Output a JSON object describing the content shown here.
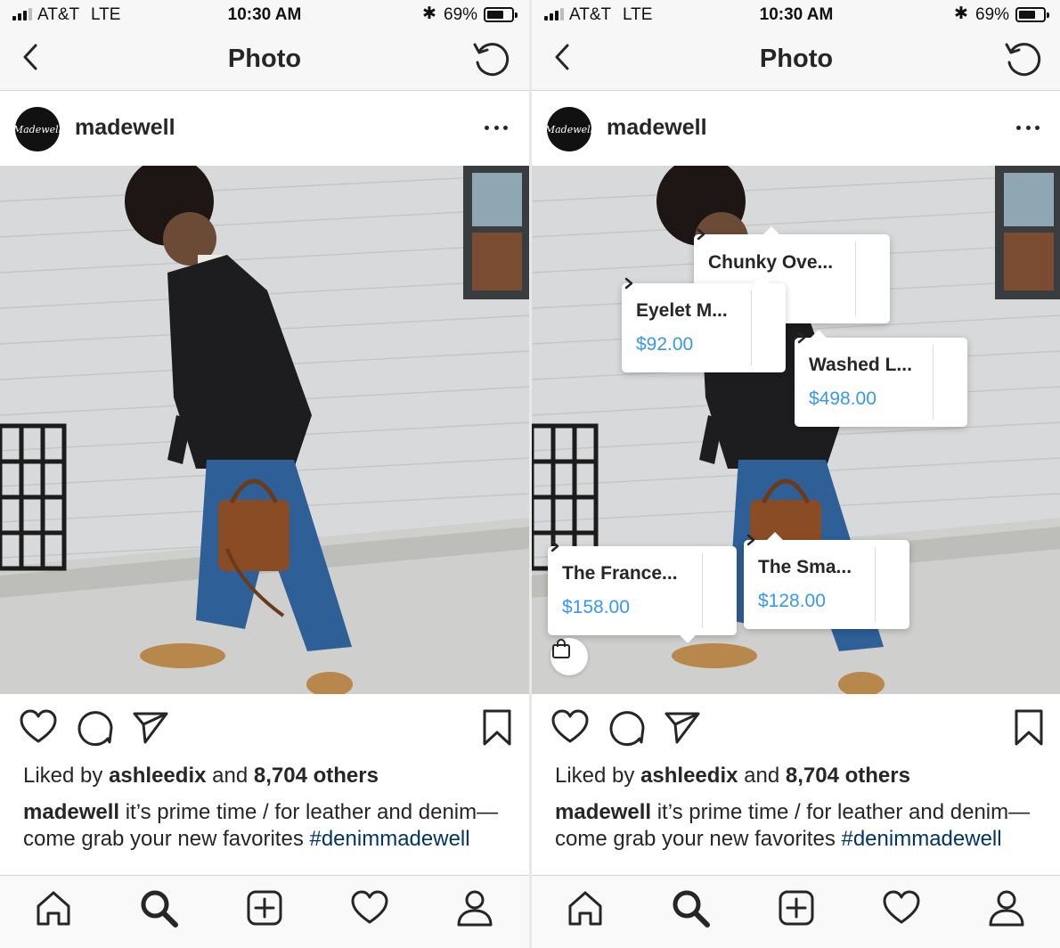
{
  "status_bar": {
    "carrier": "AT&T",
    "network": "LTE",
    "time": "10:30 AM",
    "battery_percent": "69%",
    "battery_level": 0.69
  },
  "nav": {
    "title": "Photo"
  },
  "post": {
    "avatar_text": "Madewell",
    "username": "madewell",
    "liked_by_prefix": "Liked by",
    "liked_by_user": "ashleedix",
    "liked_by_and": "and",
    "liked_by_others": "8,704 others",
    "caption_user": "madewell",
    "caption_text": "it’s prime time / for leather and denim—come grab your new favorites",
    "hashtag": "#denimmadewell"
  },
  "product_tags": [
    {
      "name": "Chunky Ove...",
      "price": ""
    },
    {
      "name": "Eyelet M...",
      "price": "$92.00"
    },
    {
      "name": "Washed L...",
      "price": "$498.00"
    },
    {
      "name": "The France...",
      "price": "$158.00"
    },
    {
      "name": "The Sma...",
      "price": "$128.00"
    }
  ],
  "icons": {
    "back": "chevron-left-icon",
    "rotate": "rotate-icon",
    "more": "more-icon",
    "like": "heart-icon",
    "comment": "comment-icon",
    "share": "send-icon",
    "save": "bookmark-icon",
    "shop": "shopping-bag-icon",
    "tabs": [
      "home-icon",
      "search-icon",
      "add-icon",
      "heart-icon",
      "profile-icon"
    ]
  },
  "colors": {
    "price_blue": "#3897f0",
    "hashtag_blue": "#003569",
    "text": "#262626",
    "bar_bg": "#f7f7f7"
  }
}
